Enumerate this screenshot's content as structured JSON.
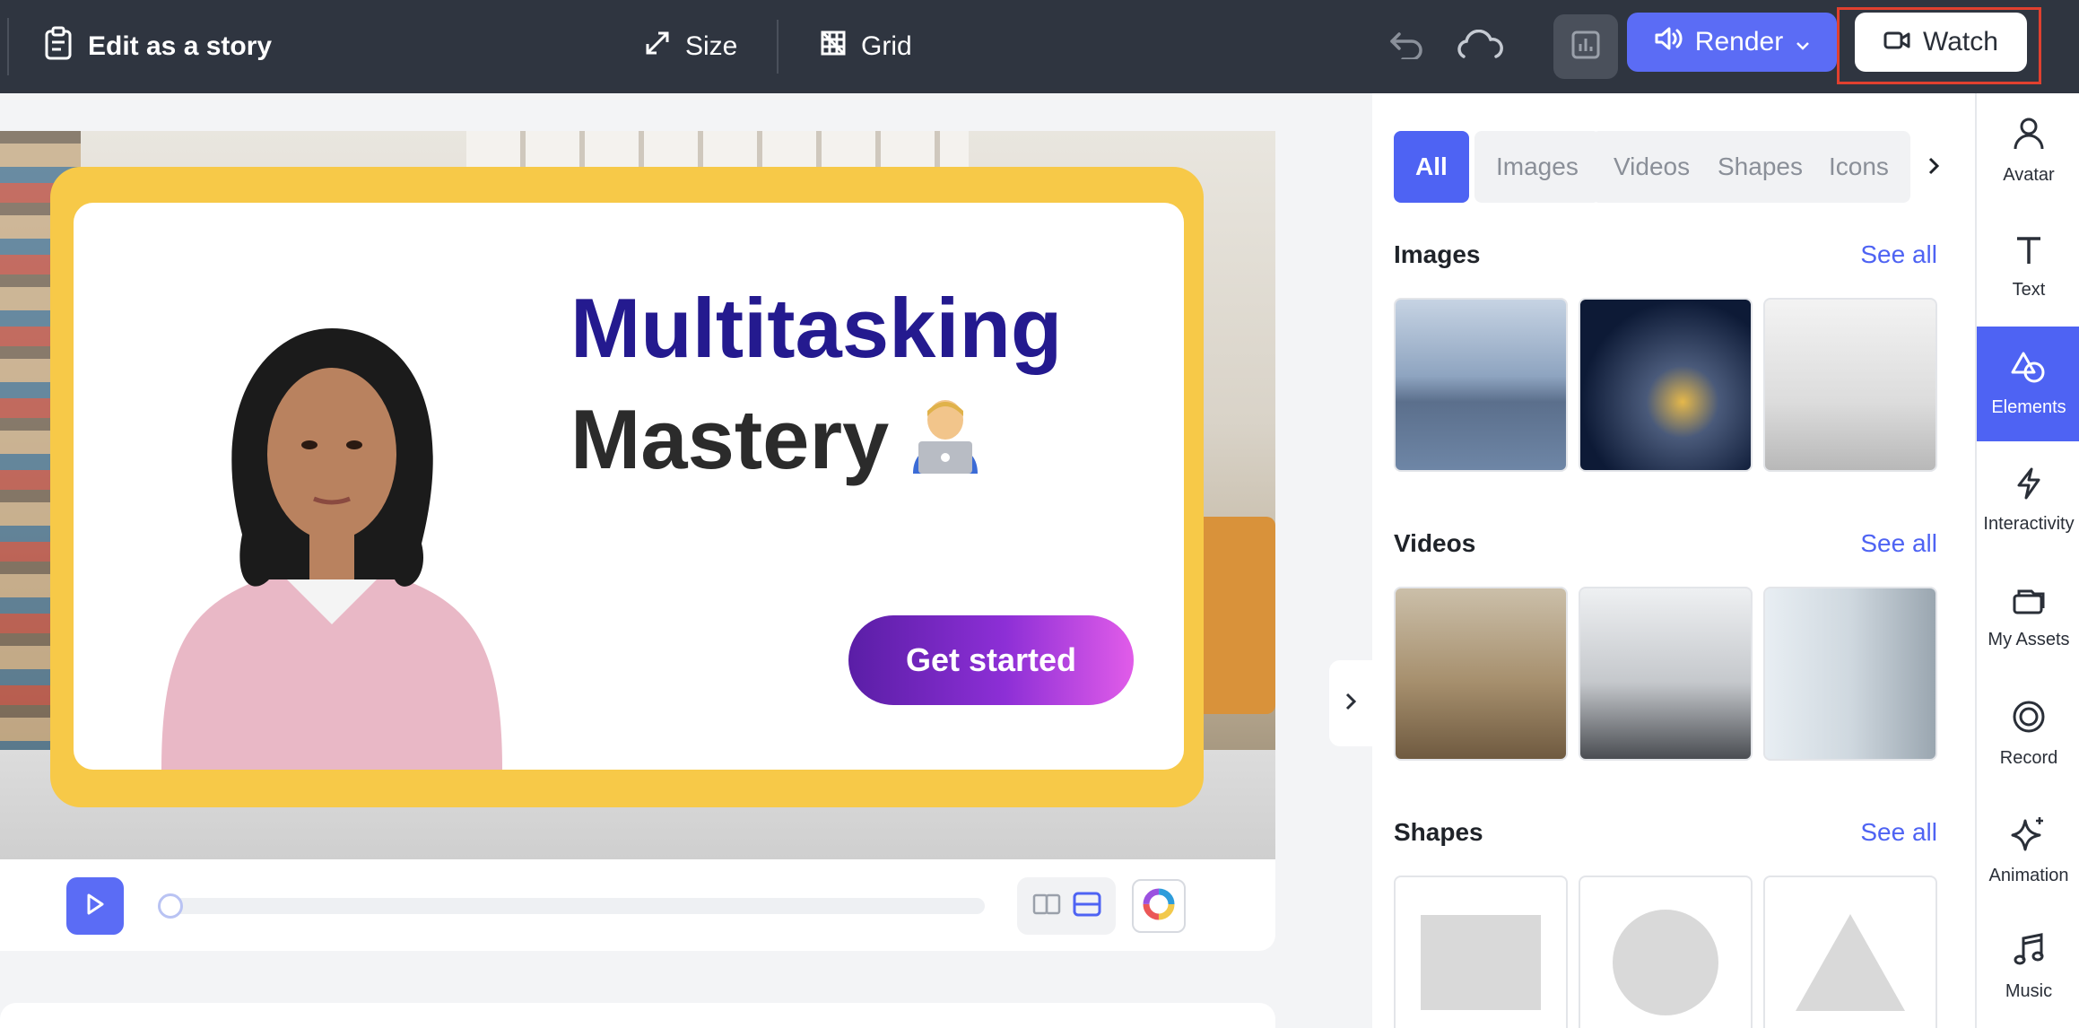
{
  "topbar": {
    "story_label": "Edit as a story",
    "size_label": "Size",
    "grid_label": "Grid",
    "render_label": "Render",
    "watch_label": "Watch"
  },
  "canvas": {
    "title_line1": "Multitasking",
    "title_line2": "Mastery",
    "cta_label": "Get started"
  },
  "elements_panel": {
    "tabs": [
      "All",
      "Images",
      "Videos",
      "Shapes",
      "Icons"
    ],
    "active_tab": "All",
    "sections": {
      "images": {
        "title": "Images",
        "see_all": "See all"
      },
      "videos": {
        "title": "Videos",
        "see_all": "See all"
      },
      "shapes": {
        "title": "Shapes",
        "see_all": "See all"
      }
    }
  },
  "rail": {
    "items": [
      {
        "label": "Avatar",
        "icon": "person-icon"
      },
      {
        "label": "Text",
        "icon": "text-icon"
      },
      {
        "label": "Elements",
        "icon": "shapes-icon"
      },
      {
        "label": "Interactivity",
        "icon": "lightning-icon"
      },
      {
        "label": "My Assets",
        "icon": "folder-icon"
      },
      {
        "label": "Record",
        "icon": "record-icon"
      },
      {
        "label": "Animation",
        "icon": "sparkle-icon"
      },
      {
        "label": "Music",
        "icon": "music-icon"
      }
    ],
    "active": "Elements"
  },
  "colors": {
    "accent": "#5b6cf5",
    "topbar": "#2f3540",
    "frame_yellow": "#f7c948",
    "title_navy": "#241a8f",
    "highlight_red": "#e0402f"
  }
}
